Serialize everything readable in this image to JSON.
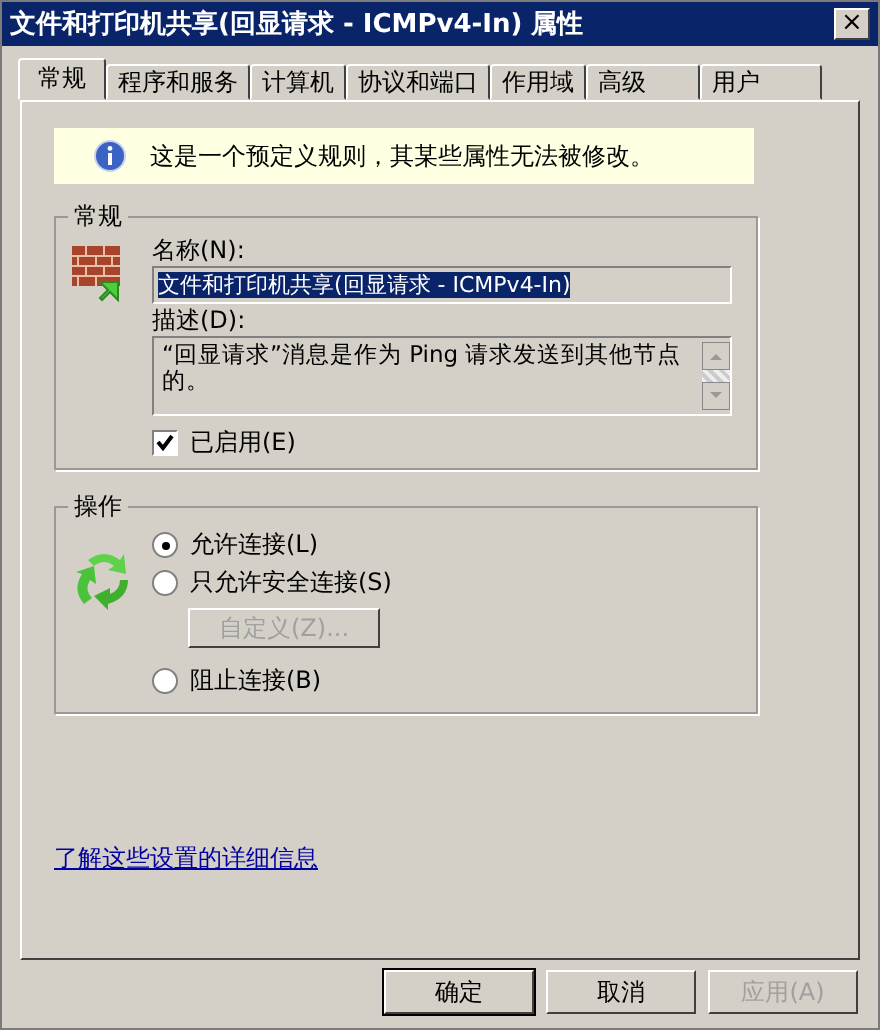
{
  "window": {
    "title": "文件和打印机共享(回显请求 - ICMPv4-In) 属性",
    "close": "×"
  },
  "tabs": [
    {
      "label": "常规",
      "selected": true
    },
    {
      "label": "程序和服务",
      "selected": false
    },
    {
      "label": "计算机",
      "selected": false
    },
    {
      "label": "协议和端口",
      "selected": false
    },
    {
      "label": "作用域",
      "selected": false
    },
    {
      "label": "高级",
      "selected": false
    },
    {
      "label": "用户",
      "selected": false
    }
  ],
  "info": "这是一个预定义规则，其某些属性无法被修改。",
  "general": {
    "title": "常规",
    "name_label": "名称(N):",
    "name_value": "文件和打印机共享(回显请求 - ICMPv4-In)",
    "description_label": "描述(D):",
    "description_value": "“回显请求”消息是作为 Ping 请求发送到其他节点的。",
    "enabled": {
      "label": "已启用(E)",
      "checked": true
    }
  },
  "action": {
    "title": "操作",
    "options": [
      {
        "label": "允许连接(L)",
        "selected": true
      },
      {
        "label": "只允许安全连接(S)",
        "selected": false
      },
      {
        "label": "阻止连接(B)",
        "selected": false
      }
    ],
    "customize": {
      "label": "自定义(Z)...",
      "disabled": true
    }
  },
  "link": "了解这些设置的详细信息",
  "buttons": [
    {
      "label": "确定",
      "default": true,
      "disabled": false
    },
    {
      "label": "取消",
      "default": false,
      "disabled": false
    },
    {
      "label": "应用(A)",
      "default": false,
      "disabled": true
    }
  ]
}
